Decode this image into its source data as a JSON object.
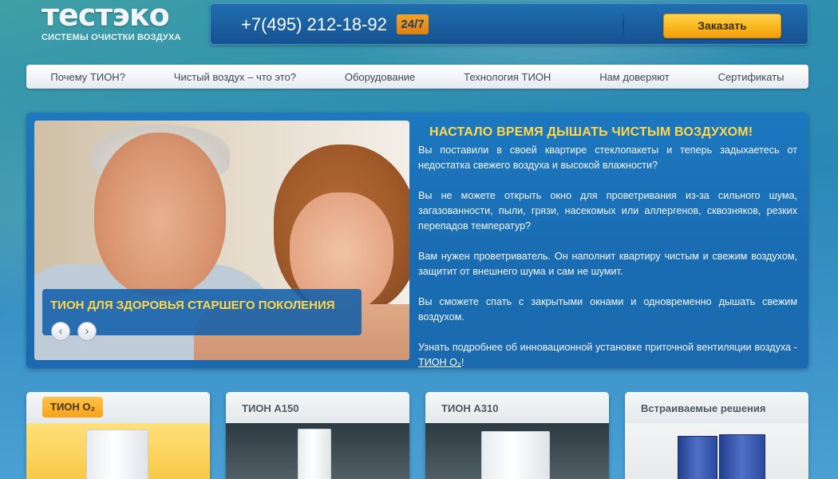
{
  "header": {
    "logo_title": "тестэко",
    "logo_subtitle": "СИСТЕМЫ ОЧИСТКИ ВОЗДУХА",
    "phone": "+7(495) 212-18-92",
    "availability_badge": "24/7",
    "order_button": "Заказать"
  },
  "nav": {
    "items": [
      {
        "label": "Почему ТИОН?"
      },
      {
        "label": "Чистый воздух – что это?"
      },
      {
        "label": "Оборудование"
      },
      {
        "label": "Технология ТИОН"
      },
      {
        "label": "Нам доверяют"
      },
      {
        "label": "Сертификаты"
      }
    ]
  },
  "hero": {
    "slide_caption": "ТИОН ДЛЯ ЗДОРОВЬЯ СТАРШЕГО ПОКОЛЕНИЯ",
    "prev_arrow": "‹",
    "next_arrow": "›",
    "heading": "НАСТАЛО ВРЕМЯ ДЫШАТЬ ЧИСТЫМ ВОЗДУХОМ!",
    "paragraphs": [
      "Вы поставили в своей квартире стеклопакеты и теперь задыхаетесь от недостатка свежего воздуха и высокой влажности?",
      "Вы не можете открыть окно для проветривания из-за сильного шума, загазованности, пыли, грязи, насекомых или аллергенов, сквозняков, резких перепадов температур?",
      "Вам нужен проветриватель. Он наполнит квартиру чистым и свежим воздухом, защитит от внешнего шума и сам не шумит.",
      "Вы сможете спать с закрытыми окнами и одновременно дышать свежим воздухом."
    ],
    "more_text": "Узнать подробнее об инновационной установке приточной вентиляции воздуха -",
    "more_link": "ТИОН O₂",
    "more_suffix": "!"
  },
  "products": [
    {
      "title": "ТИОН O₂"
    },
    {
      "title": "ТИОН А150"
    },
    {
      "title": "ТИОН А310"
    },
    {
      "title": "Встраиваемые решения"
    }
  ],
  "colors": {
    "accent_yellow": "#ffd84a",
    "button_orange": "#f9b51b",
    "panel_blue": "#1a6db3"
  }
}
